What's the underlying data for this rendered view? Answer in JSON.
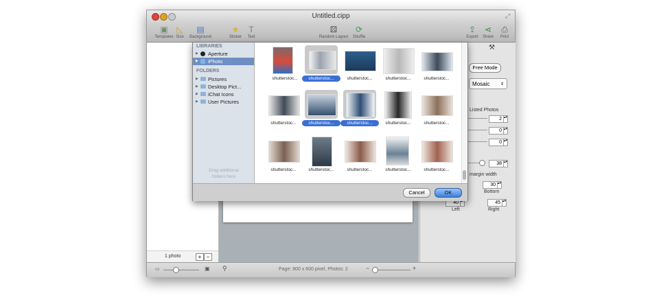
{
  "window": {
    "title": "Untitled.cipp"
  },
  "toolbar": {
    "items": [
      {
        "label": "Templates",
        "icon": "templates-icon"
      },
      {
        "label": "Size",
        "icon": "size-icon"
      },
      {
        "label": "Background",
        "icon": "background-icon"
      },
      {
        "label": "Sticker",
        "icon": "sticker-icon"
      },
      {
        "label": "Text",
        "icon": "text-icon"
      },
      {
        "label": "Random Layout",
        "icon": "random-layout-icon"
      },
      {
        "label": "Shuffle",
        "icon": "shuffle-icon"
      },
      {
        "label": "Export",
        "icon": "export-icon"
      },
      {
        "label": "Share",
        "icon": "share-icon"
      },
      {
        "label": "Print",
        "icon": "print-icon"
      }
    ]
  },
  "left_panel": {
    "photo_count": "1 photo",
    "add_label": "+",
    "remove_label": "−"
  },
  "status_bar": {
    "text": "Page: 800 x 600 pixel, Photos: 2"
  },
  "right_panel": {
    "free_mode_label": "Free Mode",
    "layout_select": "Mosaic",
    "listed_photos_label": "Listed Photos",
    "field_a": "2",
    "field_b": "0",
    "field_c": "0",
    "slider_value": "38",
    "margin_width_label": "margin width",
    "bottom_value": "30",
    "bottom_label": "Bottom",
    "left_value": "40",
    "left_label": "Left",
    "right_value": "45",
    "right_label": "Right"
  },
  "dialog": {
    "libraries_header": "LIBRARIES",
    "libraries": [
      "Aperture",
      "iPhoto"
    ],
    "folders_header": "FOLDERS",
    "folders": [
      "Pictures",
      "Desktop Pict...",
      "iChat Icons",
      "User Pictures"
    ],
    "drag_hint": "Drag additional folders here",
    "thumbnails": [
      {
        "caption": "shutterstoc...",
        "selected": false
      },
      {
        "caption": "shutterstoc...",
        "selected": true
      },
      {
        "caption": "shutterstoc...",
        "selected": false
      },
      {
        "caption": "shutterstoc...",
        "selected": false
      },
      {
        "caption": "shutterstoc...",
        "selected": false
      },
      {
        "caption": "shutterstoc...",
        "selected": false
      },
      {
        "caption": "shutterstoc...",
        "selected": true
      },
      {
        "caption": "shutterstoc...",
        "selected": true
      },
      {
        "caption": "shutterstoc...",
        "selected": false
      },
      {
        "caption": "shutterstoc...",
        "selected": false
      },
      {
        "caption": "shutterstoc...",
        "selected": false
      },
      {
        "caption": "shutterstoc...",
        "selected": false
      },
      {
        "caption": "shutterstoc...",
        "selected": false
      },
      {
        "caption": "shutterstoc...",
        "selected": false
      },
      {
        "caption": "shutterstoc...",
        "selected": false
      }
    ],
    "cancel_label": "Cancel",
    "ok_label": "OK"
  },
  "colors": {
    "accent": "#3b6fd4",
    "source_list": "#dbe2ea",
    "selection": "#6d8fc4"
  }
}
